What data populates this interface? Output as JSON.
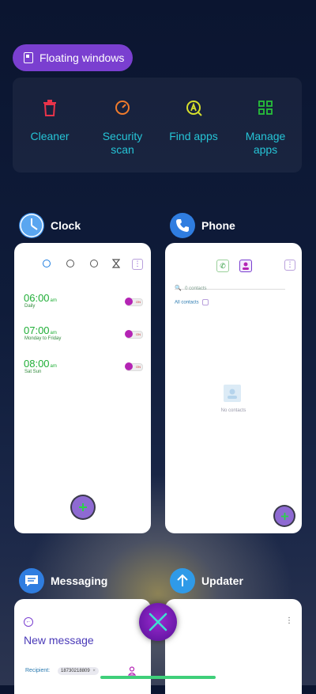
{
  "floating": {
    "label": "Floating windows"
  },
  "tools": [
    {
      "label": "Cleaner",
      "icon": "trash-icon",
      "color": "#e8334a"
    },
    {
      "label": "Security\nscan",
      "icon": "gauge-icon",
      "color": "#f07b2c"
    },
    {
      "label": "Find apps",
      "icon": "find-apps-icon",
      "color": "#d7e02c"
    },
    {
      "label": "Manage\napps",
      "icon": "grid-icon",
      "color": "#28c03a"
    }
  ],
  "clock": {
    "app_name": "Clock",
    "alarms": [
      {
        "time": "06:00",
        "ampm": "am",
        "repeat": "Daily",
        "state": "ON"
      },
      {
        "time": "07:00",
        "ampm": "am",
        "repeat": "Monday to Friday",
        "state": "ON"
      },
      {
        "time": "08:00",
        "ampm": "am",
        "repeat": "Sat Sun",
        "state": "ON"
      }
    ]
  },
  "phone": {
    "app_name": "Phone",
    "search_placeholder": "0 contacts",
    "filter_label": "All contacts",
    "empty_text": "No contacts"
  },
  "messaging": {
    "app_name": "Messaging",
    "title": "New message",
    "recipient_label": "Recipient:",
    "recipient_value": "18730218809",
    "recipient_remove": "×"
  },
  "updater": {
    "app_name": "Updater"
  },
  "colors": {
    "accent": "#7a3fd0",
    "teal": "#26c4d6",
    "green": "#1fae36"
  }
}
